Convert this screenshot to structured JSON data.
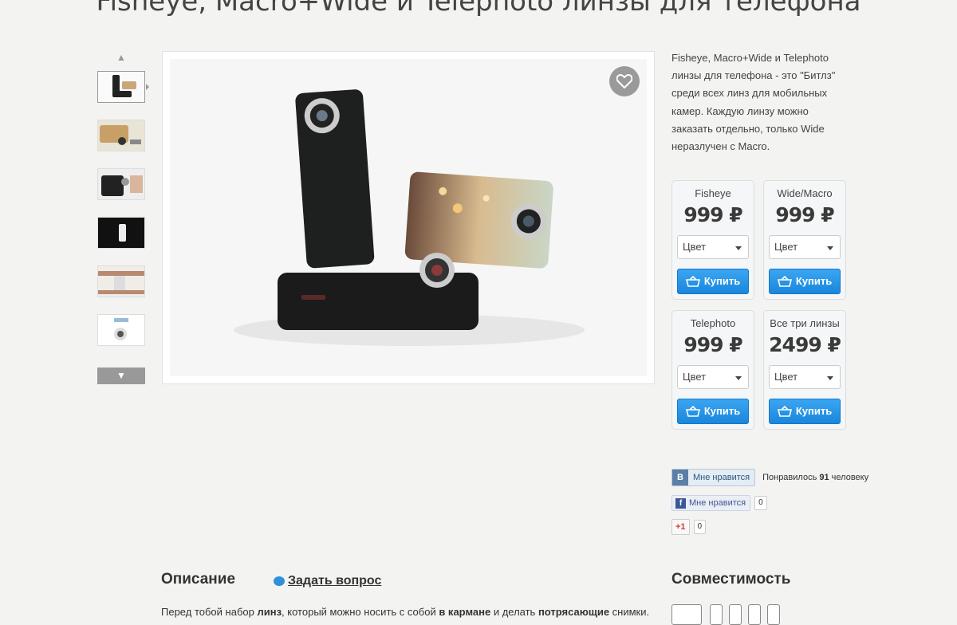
{
  "page": {
    "title": "Fisheye, Macro+Wide и Telephoto линзы для телефона"
  },
  "gallery": {
    "thumbnails": [
      "thumb-1",
      "thumb-2",
      "thumb-3",
      "thumb-4",
      "thumb-5",
      "thumb-6"
    ],
    "active_index": 0,
    "up_arrow": "▲",
    "down_arrow": "▼",
    "favorite_icon": "heart-icon"
  },
  "description": {
    "text": "Fisheye, Macro+Wide и Telephoto линзы для телефона - это \"Битлз\" среди всех линз для мобильных камер. Каждую линзу можно заказать отдельно, только Wide неразлучен с Macro."
  },
  "products": [
    {
      "name": "Fisheye",
      "price": "999 ₽",
      "select_value": "Цвет",
      "buy_label": "Купить"
    },
    {
      "name": "Wide/Macro",
      "price": "999 ₽",
      "select_value": "Цвет",
      "buy_label": "Купить"
    },
    {
      "name": "Telephoto",
      "price": "999 ₽",
      "select_value": "Цвет",
      "buy_label": "Купить"
    },
    {
      "name": "Все три линзы",
      "price": "2499 ₽",
      "select_value": "Цвет",
      "buy_label": "Купить"
    }
  ],
  "social": {
    "vk": {
      "logo": "B",
      "label": "Мне нравится",
      "count_prefix": "Понравилось ",
      "count": "91",
      "count_suffix": " человеку"
    },
    "facebook": {
      "logo": "f",
      "label": "Мне нравится",
      "count": "0"
    },
    "google": {
      "label": "+1",
      "count": "0"
    }
  },
  "bottom": {
    "description_heading": "Описание",
    "ask_label": "Задать вопрос",
    "compat_heading": "Совместимость",
    "text_parts": [
      "Перед тобой набор ",
      "линз",
      ", который можно носить с собой ",
      "в кармане",
      " и делать ",
      "потрясающие",
      " снимки."
    ]
  },
  "colors": {
    "accent": "#1a86dd",
    "background": "#f3f3f2"
  }
}
